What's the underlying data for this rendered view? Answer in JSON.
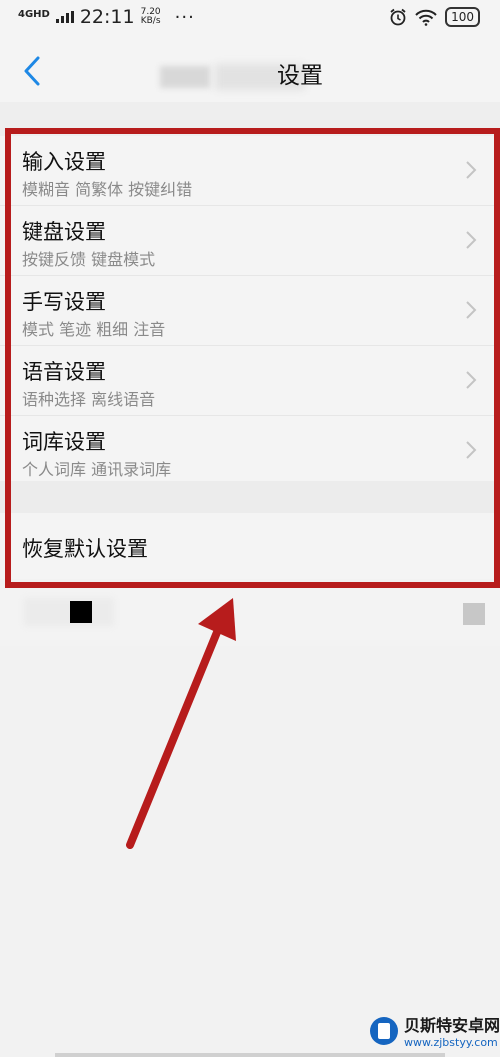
{
  "status_bar": {
    "network": "4GHD",
    "time": "22:11",
    "speed_value": "7.20",
    "speed_unit": "KB/s",
    "more": "···",
    "battery": "100"
  },
  "header": {
    "title": "设置"
  },
  "settings": [
    {
      "title": "输入设置",
      "subtitle": "模糊音 简繁体 按键纠错"
    },
    {
      "title": "键盘设置",
      "subtitle": "按键反馈 键盘模式"
    },
    {
      "title": "手写设置",
      "subtitle": "模式 笔迹 粗细 注音"
    },
    {
      "title": "语音设置",
      "subtitle": "语种选择 离线语音"
    },
    {
      "title": "词库设置",
      "subtitle": "个人词库 通讯录词库"
    }
  ],
  "reset": {
    "label": "恢复默认设置"
  },
  "watermark": {
    "brand": "贝斯特安卓网",
    "url": "www.zjbstyy.com"
  },
  "colors": {
    "highlight": "#b71c1c",
    "accent": "#1e88e5"
  }
}
